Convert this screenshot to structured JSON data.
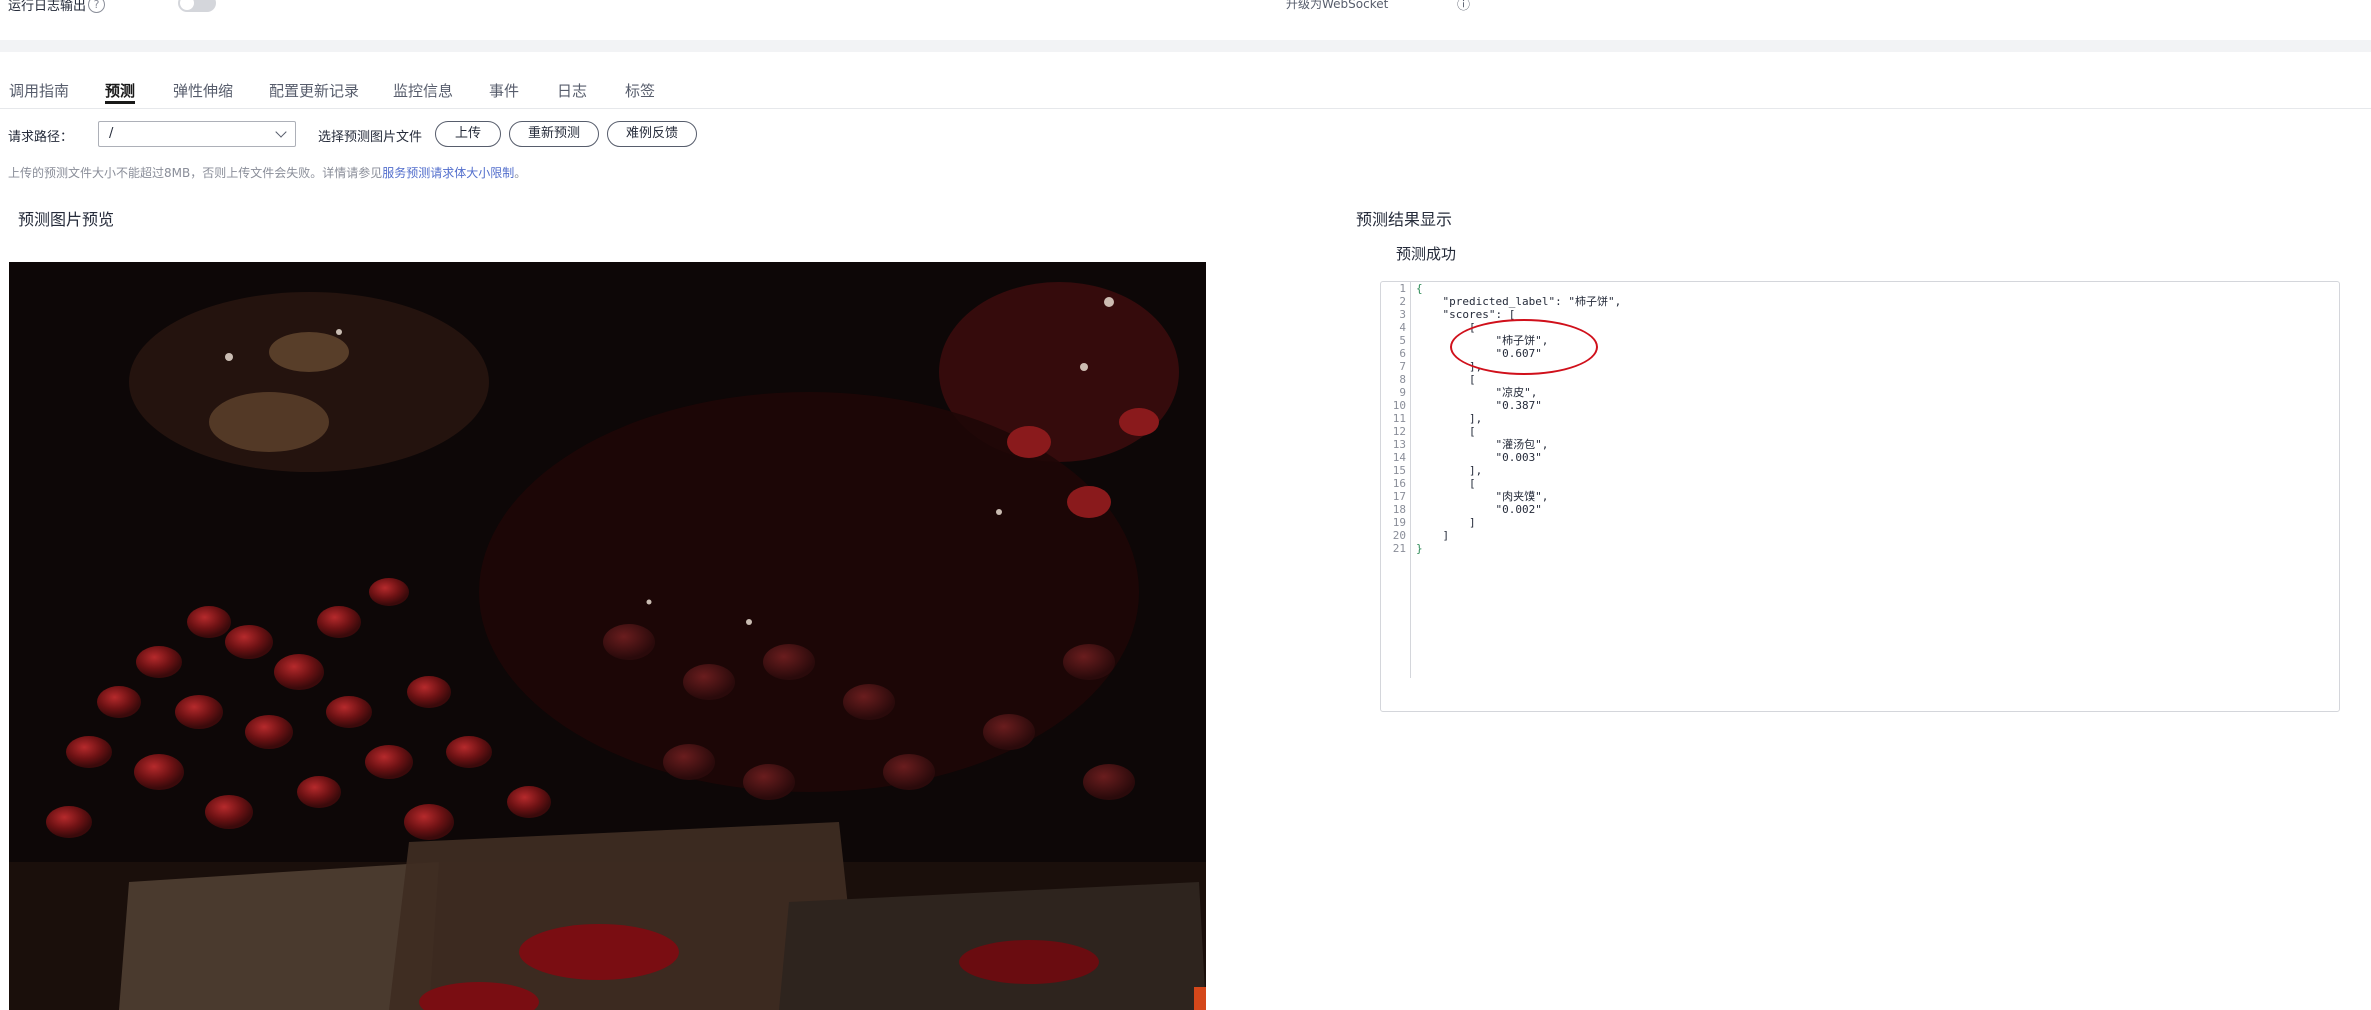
{
  "top": {
    "log_label": "运行日志输出",
    "help_icon": "help-circle-icon",
    "websocket_label": "升级为WebSocket",
    "websocket_icon": "info-icon"
  },
  "tabs": [
    {
      "label": "调用指南",
      "active": false
    },
    {
      "label": "预测",
      "active": true
    },
    {
      "label": "弹性伸缩",
      "active": false
    },
    {
      "label": "配置更新记录",
      "active": false
    },
    {
      "label": "监控信息",
      "active": false
    },
    {
      "label": "事件",
      "active": false
    },
    {
      "label": "日志",
      "active": false
    },
    {
      "label": "标签",
      "active": false
    }
  ],
  "toolbar": {
    "path_label": "请求路径：",
    "path_value": "/",
    "file_label": "选择预测图片文件",
    "upload_label": "上传",
    "repredict_label": "重新预测",
    "feedback_label": "难例反馈"
  },
  "hint": {
    "text": "上传的预测文件大小不能超过8MB，否则上传文件会失败。详情请参见",
    "link": "服务预测请求体大小限制",
    "end": "。"
  },
  "preview": {
    "title": "预测图片预览"
  },
  "result": {
    "title": "预测结果显示",
    "status": "预测成功",
    "code_lines": [
      "{",
      "    \"predicted_label\": \"柿子饼\",",
      "    \"scores\": [",
      "        [",
      "            \"柿子饼\",",
      "            \"0.607\"",
      "        ],",
      "        [",
      "            \"凉皮\",",
      "            \"0.387\"",
      "        ],",
      "        [",
      "            \"灌汤包\",",
      "            \"0.003\"",
      "        ],",
      "        [",
      "            \"肉夹馍\",",
      "            \"0.002\"",
      "        ]",
      "    ]",
      "}"
    ]
  },
  "colors": {
    "accent": "#191919",
    "link": "#526ecc",
    "annotation": "#d0101b"
  }
}
